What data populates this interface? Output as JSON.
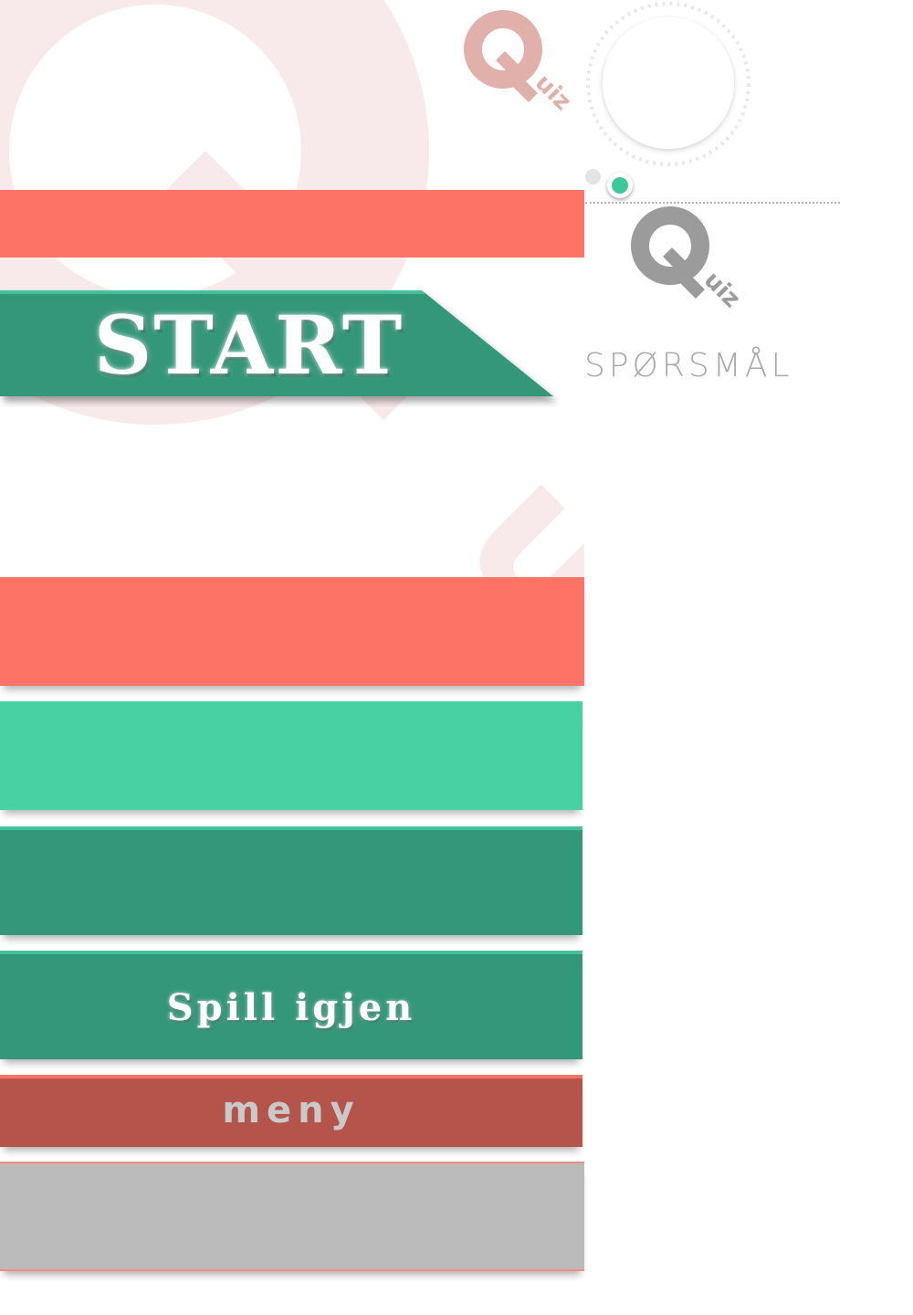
{
  "colors": {
    "coral": "#fd7366",
    "mint": "#48d1a3",
    "green": "#35977a",
    "brick": "#b4544a",
    "grey": "#bababa",
    "accent_dot": "#3cc99a"
  },
  "logo": {
    "letter": "Q",
    "suffix": "uiz"
  },
  "header": {
    "questions_label": "SPØRSMÅL"
  },
  "start": {
    "label": "START"
  },
  "buttons": {
    "play_again_label": "Spill igjen",
    "menu_label": "meny"
  }
}
